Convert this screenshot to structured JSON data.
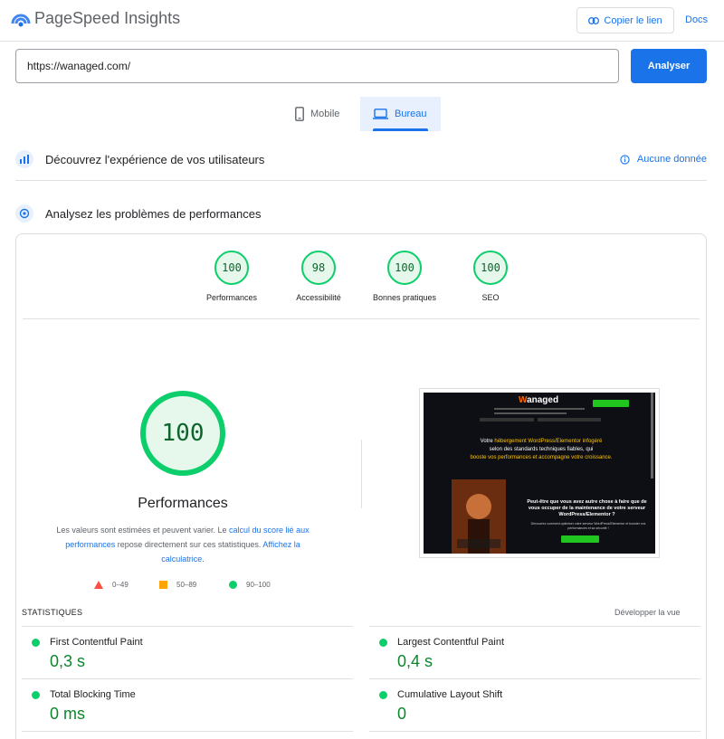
{
  "app": {
    "title": "PageSpeed Insights"
  },
  "header": {
    "copy_link_label": "Copier le lien",
    "docs_label": "Docs"
  },
  "search": {
    "url_value": "https://wanaged.com/",
    "analyze_label": "Analyser"
  },
  "tabs": [
    {
      "label": "Mobile",
      "icon": "phone-icon",
      "selected": false
    },
    {
      "label": "Bureau",
      "icon": "laptop-icon",
      "selected": true
    }
  ],
  "field_data": {
    "title": "Découvrez l'expérience de vos utilisateurs",
    "no_data_label": "Aucune donnée"
  },
  "lab_data": {
    "title": "Analysez les problèmes de performances"
  },
  "scores": [
    {
      "label": "Performances",
      "value": "100"
    },
    {
      "label": "Accessibilité",
      "value": "98"
    },
    {
      "label": "Bonnes pratiques",
      "value": "100"
    },
    {
      "label": "SEO",
      "value": "100"
    }
  ],
  "main_score": {
    "value": "100",
    "label": "Performances",
    "disclaimer": {
      "text1": "Les valeurs sont estimées et peuvent varier. Le ",
      "link1": "calcul du score lié aux performances",
      "text2": " repose directement sur ces statistiques. ",
      "link2": "Affichez la calculatrice",
      "text3": "."
    }
  },
  "legend": [
    {
      "range": "0–49",
      "color": "#ff4e42",
      "shape": "triangle"
    },
    {
      "range": "50–89",
      "color": "#ffa400",
      "shape": "square"
    },
    {
      "range": "90–100",
      "color": "#0cce6b",
      "shape": "circle"
    }
  ],
  "screenshot": {
    "logo": "Wanaged",
    "headline_1": "Votre ",
    "headline_hl": "hébergement WordPress/Elementor infogéré",
    "headline_2": "selon des standards techniques fiables, qui",
    "headline_3": "booste vos performances et accompagne votre croissance.",
    "question": "Peut-être que vous avez autre chose à faire que de vous occuper de la maintenance de votre serveur WordPress/Elementor ?",
    "sub": "Découvrez comment optimiser votre serveur WordPress/Elementor et booster vos performances et sa sécurité !"
  },
  "statistics": {
    "title": "STATISTIQUES",
    "expand_label": "Développer la vue",
    "metrics": [
      {
        "name": "First Contentful Paint",
        "value": "0,3 s"
      },
      {
        "name": "Largest Contentful Paint",
        "value": "0,4 s"
      },
      {
        "name": "Total Blocking Time",
        "value": "0 ms"
      },
      {
        "name": "Cumulative Layout Shift",
        "value": "0"
      }
    ]
  },
  "colors": {
    "accent": "#1a73e8",
    "pass": "#0cce6b",
    "pass_text": "#0d652d",
    "average": "#ffa400",
    "fail": "#ff4e42"
  }
}
